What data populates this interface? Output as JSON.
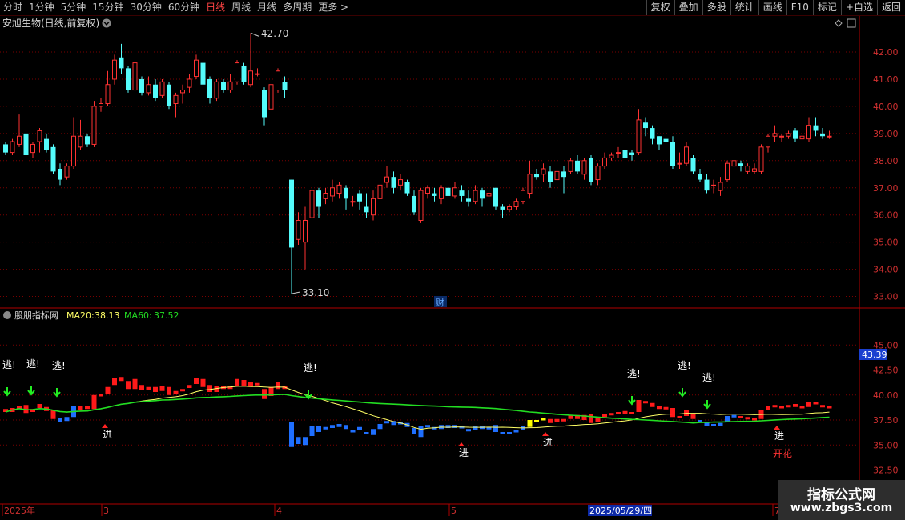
{
  "toolbar": {
    "periods": [
      "分时",
      "1分钟",
      "5分钟",
      "15分钟",
      "30分钟",
      "60分钟",
      "日线",
      "周线",
      "月线",
      "多周期",
      "更多"
    ],
    "active_period": "日线",
    "more_arrow": ">",
    "right_buttons": [
      "复权",
      "叠加",
      "多股",
      "统计",
      "画线",
      "F10",
      "标记",
      "+自选",
      "返回"
    ]
  },
  "main_panel": {
    "title": "安旭生物(日线,前复权)",
    "high_label": "42.70",
    "low_label": "33.10",
    "cai_badge": "财",
    "y_ticks": [
      "42.00",
      "41.00",
      "40.00",
      "39.00",
      "38.00",
      "37.00",
      "36.00",
      "35.00",
      "34.00",
      "33.00"
    ]
  },
  "indicator_panel": {
    "name": "股朋指标网",
    "ma20_label": "MA20:",
    "ma20_value": "38.13",
    "ma60_label": "MA60:",
    "ma60_value": "37.52",
    "current_value": "43.39",
    "y_ticks": [
      "45.00",
      "42.50",
      "40.00",
      "37.50",
      "35.00",
      "32.50"
    ],
    "escape_text": "逃!",
    "enter_text": "进",
    "bloom_text": "开花"
  },
  "date_axis": {
    "labels": [
      "2025年",
      "3",
      "4",
      "5",
      "7"
    ],
    "cursor_date": "2025/05/29/四"
  },
  "watermark": {
    "title": "指标公式网",
    "url": "www.zbgs3.com"
  },
  "colors": {
    "up": "#ff3232",
    "down": "#54fcfc",
    "ind_up": "#ff1a1a",
    "ind_down": "#1f6fff",
    "ind_yellow": "#ffff00",
    "ma20": "#ffff66",
    "ma60": "#22dd22",
    "grid": "#7a0000",
    "axis_text": "#d03030"
  },
  "chart_data": {
    "type": "candlestick",
    "price_range": [
      32.8,
      42.9
    ],
    "candles": [
      [
        38.6,
        38.3,
        38.7,
        38.2
      ],
      [
        38.3,
        38.7,
        38.8,
        38.2
      ],
      [
        38.6,
        38.9,
        39.7,
        38.5
      ],
      [
        39.0,
        38.2,
        39.1,
        38.1
      ],
      [
        38.3,
        38.6,
        38.7,
        38.1
      ],
      [
        38.7,
        39.1,
        39.2,
        38.3
      ],
      [
        38.8,
        38.4,
        39.0,
        38.3
      ],
      [
        38.5,
        37.6,
        38.6,
        37.5
      ],
      [
        37.7,
        37.3,
        37.9,
        37.1
      ],
      [
        37.4,
        37.8,
        37.9,
        37.3
      ],
      [
        37.8,
        38.9,
        39.6,
        37.7
      ],
      [
        38.5,
        38.9,
        39.5,
        38.4
      ],
      [
        38.9,
        38.6,
        39.0,
        38.5
      ],
      [
        38.6,
        40.0,
        40.2,
        38.5
      ],
      [
        40.0,
        40.1,
        40.3,
        39.8
      ],
      [
        40.1,
        40.8,
        41.3,
        40.0
      ],
      [
        41.0,
        41.7,
        41.9,
        40.8
      ],
      [
        41.8,
        41.4,
        42.3,
        41.2
      ],
      [
        41.4,
        40.6,
        41.5,
        40.5
      ],
      [
        40.6,
        41.6,
        41.7,
        40.4
      ],
      [
        41.0,
        40.5,
        41.1,
        40.4
      ],
      [
        40.5,
        40.8,
        41.1,
        40.4
      ],
      [
        40.8,
        40.3,
        41.0,
        40.2
      ],
      [
        40.4,
        40.9,
        41.0,
        40.3
      ],
      [
        40.8,
        40.0,
        40.9,
        39.9
      ],
      [
        40.1,
        40.4,
        40.5,
        39.6
      ],
      [
        40.5,
        40.6,
        40.8,
        40.1
      ],
      [
        40.7,
        41.0,
        41.2,
        40.5
      ],
      [
        41.1,
        41.7,
        41.9,
        41.0
      ],
      [
        41.6,
        40.8,
        41.7,
        40.7
      ],
      [
        41.0,
        40.3,
        41.1,
        40.1
      ],
      [
        40.3,
        40.9,
        41.0,
        40.2
      ],
      [
        40.9,
        40.6,
        41.0,
        40.5
      ],
      [
        40.6,
        40.9,
        41.2,
        40.5
      ],
      [
        40.9,
        41.6,
        41.7,
        40.8
      ],
      [
        41.5,
        40.9,
        41.6,
        40.8
      ],
      [
        40.8,
        41.3,
        42.7,
        40.7
      ],
      [
        41.2,
        41.2,
        41.4,
        41.1
      ],
      [
        40.6,
        39.6,
        40.7,
        39.3
      ],
      [
        39.9,
        40.8,
        41.0,
        39.8
      ],
      [
        40.6,
        41.3,
        41.4,
        40.5
      ],
      [
        40.9,
        40.6,
        41.1,
        40.3
      ],
      [
        37.3,
        34.8,
        37.3,
        33.1
      ],
      [
        35.1,
        35.8,
        36.1,
        34.9
      ],
      [
        35.0,
        35.8,
        36.3,
        34.0
      ],
      [
        35.9,
        36.9,
        37.4,
        35.8
      ],
      [
        36.9,
        36.3,
        37.0,
        35.9
      ],
      [
        36.6,
        36.8,
        37.0,
        36.4
      ],
      [
        36.7,
        37.0,
        37.3,
        36.5
      ],
      [
        36.8,
        37.1,
        37.2,
        36.6
      ],
      [
        37.0,
        36.6,
        37.1,
        36.2
      ],
      [
        36.5,
        36.5,
        36.7,
        36.3
      ],
      [
        36.8,
        36.5,
        36.9,
        36.2
      ],
      [
        36.3,
        36.1,
        36.8,
        35.9
      ],
      [
        36.0,
        36.6,
        36.9,
        35.8
      ],
      [
        36.6,
        37.1,
        37.2,
        36.5
      ],
      [
        37.2,
        37.4,
        37.8,
        37.0
      ],
      [
        37.4,
        37.0,
        37.6,
        36.8
      ],
      [
        37.1,
        37.3,
        37.5,
        36.9
      ],
      [
        37.2,
        36.8,
        37.3,
        36.7
      ],
      [
        36.7,
        36.1,
        36.9,
        36.0
      ],
      [
        35.8,
        36.9,
        37.0,
        35.7
      ],
      [
        36.8,
        37.0,
        37.1,
        36.6
      ],
      [
        36.8,
        36.7,
        37.0,
        36.5
      ],
      [
        36.6,
        37.0,
        37.1,
        36.4
      ],
      [
        37.0,
        36.7,
        37.1,
        36.6
      ],
      [
        36.7,
        37.0,
        37.2,
        36.6
      ],
      [
        36.9,
        36.7,
        37.1,
        36.5
      ],
      [
        36.6,
        36.5,
        36.9,
        36.3
      ],
      [
        36.5,
        36.9,
        37.1,
        36.4
      ],
      [
        36.9,
        36.6,
        37.0,
        36.3
      ],
      [
        36.7,
        36.8,
        36.9,
        36.6
      ],
      [
        37.0,
        36.3,
        37.0,
        36.2
      ],
      [
        36.3,
        36.2,
        36.4,
        35.9
      ],
      [
        36.2,
        36.3,
        36.4,
        36.1
      ],
      [
        36.3,
        36.5,
        36.6,
        36.2
      ],
      [
        36.5,
        36.9,
        37.0,
        36.4
      ],
      [
        36.8,
        37.5,
        38.0,
        36.6
      ],
      [
        37.5,
        37.4,
        37.7,
        37.3
      ],
      [
        37.5,
        37.7,
        37.9,
        37.2
      ],
      [
        37.6,
        37.2,
        37.8,
        37.0
      ],
      [
        37.3,
        37.6,
        37.8,
        37.0
      ],
      [
        37.6,
        37.4,
        37.8,
        36.8
      ],
      [
        37.6,
        38.0,
        38.1,
        37.5
      ],
      [
        38.0,
        37.6,
        38.2,
        37.5
      ],
      [
        37.5,
        38.0,
        38.1,
        37.3
      ],
      [
        38.1,
        37.2,
        38.2,
        37.1
      ],
      [
        37.3,
        37.8,
        37.9,
        37.1
      ],
      [
        37.8,
        38.1,
        38.3,
        37.7
      ],
      [
        38.1,
        38.2,
        38.3,
        38.0
      ],
      [
        38.3,
        38.3,
        38.5,
        38.1
      ],
      [
        38.4,
        38.1,
        38.6,
        38.0
      ],
      [
        38.3,
        38.2,
        38.4,
        38.0
      ],
      [
        38.3,
        39.5,
        39.9,
        38.2
      ],
      [
        39.4,
        39.2,
        39.6,
        38.9
      ],
      [
        39.2,
        38.8,
        39.3,
        38.6
      ],
      [
        38.9,
        38.6,
        38.9,
        38.4
      ],
      [
        38.8,
        38.7,
        38.9,
        38.5
      ],
      [
        38.7,
        37.8,
        38.9,
        37.7
      ],
      [
        37.9,
        37.9,
        38.3,
        37.7
      ],
      [
        37.9,
        38.5,
        38.7,
        37.8
      ],
      [
        38.1,
        37.6,
        38.2,
        37.5
      ],
      [
        37.5,
        37.3,
        37.7,
        37.2
      ],
      [
        37.3,
        36.9,
        37.5,
        36.8
      ],
      [
        37.1,
        37.1,
        37.3,
        36.8
      ],
      [
        36.9,
        37.2,
        37.4,
        36.7
      ],
      [
        37.3,
        37.9,
        38.0,
        37.2
      ],
      [
        37.8,
        38.0,
        38.1,
        37.7
      ],
      [
        37.9,
        37.8,
        38.0,
        37.6
      ],
      [
        37.6,
        37.8,
        37.9,
        37.5
      ],
      [
        37.6,
        37.7,
        37.9,
        37.5
      ],
      [
        37.6,
        38.5,
        38.6,
        37.5
      ],
      [
        38.5,
        38.9,
        39.0,
        38.3
      ],
      [
        38.9,
        39.0,
        39.3,
        38.7
      ],
      [
        38.9,
        38.9,
        39.0,
        38.7
      ],
      [
        38.9,
        39.0,
        39.1,
        38.8
      ],
      [
        39.1,
        38.8,
        39.2,
        38.7
      ],
      [
        38.8,
        38.9,
        39.0,
        38.5
      ],
      [
        38.8,
        39.3,
        39.6,
        38.7
      ],
      [
        39.3,
        39.1,
        39.6,
        38.9
      ],
      [
        39.0,
        38.9,
        39.2,
        38.8
      ],
      [
        38.9,
        38.9,
        39.1,
        38.8
      ]
    ]
  }
}
